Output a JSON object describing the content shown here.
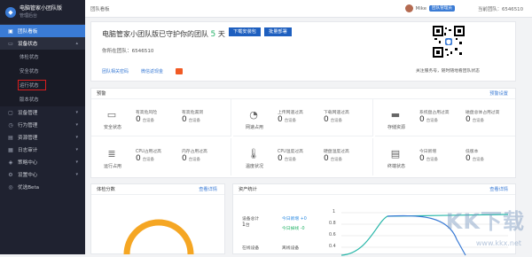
{
  "app": {
    "title": "电脑管家小团队版",
    "subtitle": "管理后台"
  },
  "sidebar": {
    "items": [
      {
        "label": "团队看板",
        "icon": "dashboard-icon"
      },
      {
        "label": "设备状态",
        "icon": "monitor-icon"
      }
    ],
    "sub_items": [
      {
        "label": "体检状态"
      },
      {
        "label": "安全状态"
      },
      {
        "label": "运行状态"
      },
      {
        "label": "版本状态"
      }
    ],
    "more": [
      {
        "label": "设备管理",
        "icon": "device-icon"
      },
      {
        "label": "行为管理",
        "icon": "behavior-icon"
      },
      {
        "label": "资源管理",
        "icon": "resource-icon"
      },
      {
        "label": "日志审计",
        "icon": "log-icon"
      },
      {
        "label": "策略中心",
        "icon": "policy-icon"
      },
      {
        "label": "设置中心",
        "icon": "settings-icon"
      },
      {
        "label": "优选Beta",
        "icon": "beta-icon"
      }
    ]
  },
  "topbar": {
    "breadcrumb": "团队看板",
    "user": "Mike",
    "badge": "团队管理员",
    "team_id": "当前团队：6546510"
  },
  "hero": {
    "title_prefix": "电脑管家小团队版已守护你的团队",
    "days": "5",
    "days_unit": "天",
    "download_btn": "下载安装包",
    "deploy_btn": "批量部署",
    "team_id": "你所在团队：6546510",
    "link1": "团队相关密码",
    "link2": "微信返现金",
    "qr_caption": "关注服务号，随时随地看团队状态"
  },
  "alarm": {
    "title": "预警",
    "link": "预警设置",
    "cells": [
      {
        "label": "安全状态",
        "icon": "shield-monitor-icon",
        "stats": [
          {
            "name": "有高危风险",
            "value": "0",
            "unit": "台设备"
          },
          {
            "name": "有高危漏洞",
            "value": "0",
            "unit": "台设备"
          }
        ]
      },
      {
        "label": "网速占用",
        "icon": "speed-icon",
        "stats": [
          {
            "name": "上传网速过高",
            "value": "0",
            "unit": "台设备"
          },
          {
            "name": "下载网速过高",
            "value": "0",
            "unit": "台设备"
          }
        ]
      },
      {
        "label": "存储资源",
        "icon": "disk-icon",
        "stats": [
          {
            "name": "系统盘占用过高",
            "value": "0",
            "unit": "台设备"
          },
          {
            "name": "磁盘总体占用过高",
            "value": "0",
            "unit": "台设备"
          }
        ]
      },
      {
        "label": "运行占用",
        "icon": "cpu-icon",
        "stats": [
          {
            "name": "CPU占用过高",
            "value": "0",
            "unit": "台设备"
          },
          {
            "name": "内存占用过高",
            "value": "0",
            "unit": "台设备"
          }
        ]
      },
      {
        "label": "温度状况",
        "icon": "thermometer-icon",
        "stats": [
          {
            "name": "CPU温度过高",
            "value": "0",
            "unit": "台设备"
          },
          {
            "name": "硬盘温度过高",
            "value": "0",
            "unit": "台设备"
          }
        ]
      },
      {
        "label": "终端状态",
        "icon": "terminal-icon",
        "stats": [
          {
            "name": "今日新增",
            "value": "0",
            "unit": "台设备"
          },
          {
            "name": "低版本",
            "value": "0",
            "unit": "台设备"
          }
        ]
      }
    ]
  },
  "score": {
    "title": "体检分数",
    "link": "查看详情"
  },
  "assets": {
    "title": "资产统计",
    "link": "查看详情",
    "total_label": "设备总计",
    "total_value": "1",
    "total_unit": "台",
    "today_new": "今日新增 +0",
    "today_drop": "今日掉线 -0",
    "online_label": "在线设备",
    "offline_label": "离线设备",
    "y_ticks": [
      "1",
      "0.8",
      "0.6",
      "0.4"
    ]
  },
  "watermark": {
    "text": "KK下载",
    "url": "www.kkx.net"
  },
  "colors": {
    "sidebar_bg": "#1f2230",
    "accent": "#3a7bd5",
    "button": "#1e5fbf",
    "highlight_box": "#d81e1e",
    "days": "#27b36a"
  }
}
